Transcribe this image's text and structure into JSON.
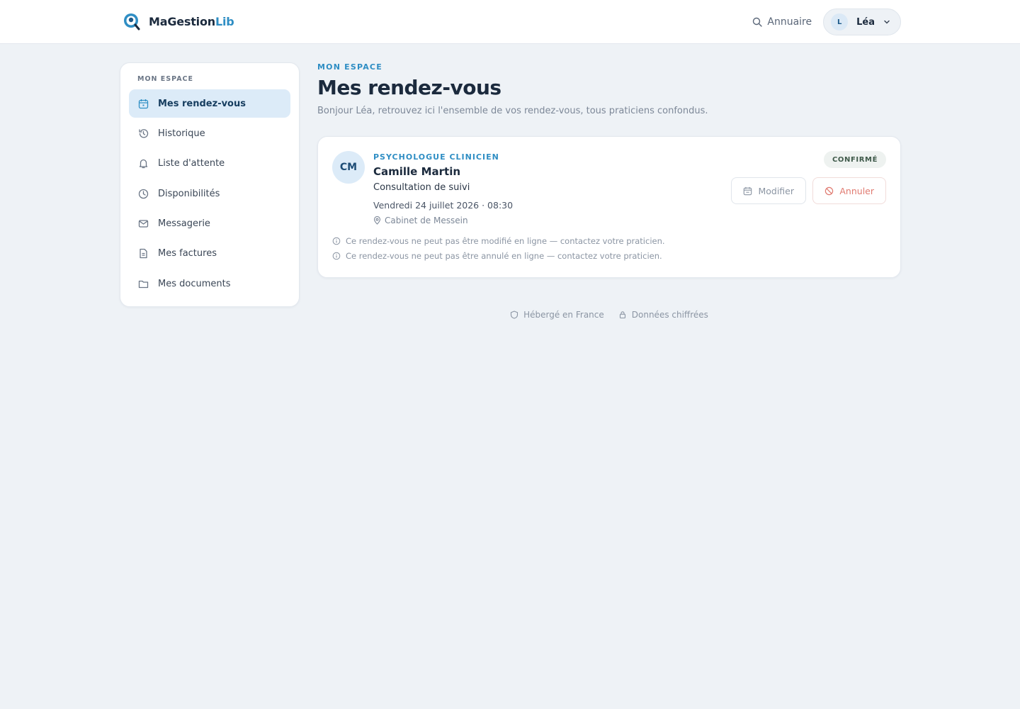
{
  "header": {
    "brand_main": "MaGestion",
    "brand_accent": "Lib",
    "directory_label": "Annuaire",
    "user_initial": "L",
    "user_name": "Léa"
  },
  "sidebar": {
    "title": "MON ESPACE",
    "items": [
      {
        "label": "Mes rendez-vous",
        "icon": "calendar-icon",
        "active": true
      },
      {
        "label": "Historique",
        "icon": "history-icon"
      },
      {
        "label": "Liste d'attente",
        "icon": "bell-icon"
      },
      {
        "label": "Disponibilités",
        "icon": "clock-icon"
      },
      {
        "label": "Messagerie",
        "icon": "mail-icon"
      },
      {
        "label": "Mes factures",
        "icon": "invoice-icon"
      },
      {
        "label": "Mes documents",
        "icon": "folder-icon"
      }
    ]
  },
  "main": {
    "eyebrow": "MON ESPACE",
    "title": "Mes rendez-vous",
    "subtitle": "Bonjour Léa, retrouvez ici l'ensemble de vos rendez-vous, tous praticiens confondus."
  },
  "appointment": {
    "initials": "CM",
    "specialty": "PSYCHOLOGUE CLINICIEN",
    "practitioner": "Camille Martin",
    "reason": "Consultation de suivi",
    "datetime": "Vendredi 24 juillet 2026 · 08:30",
    "location": "Cabinet de Messein",
    "status": "CONFIRMÉ",
    "modify_label": "Modifier",
    "cancel_label": "Annuler",
    "notes": [
      "Ce rendez-vous ne peut pas être modifié en ligne — contactez votre praticien.",
      "Ce rendez-vous ne peut pas être annulé en ligne — contactez votre praticien."
    ]
  },
  "trust": {
    "hosted": "Hébergé en France",
    "encrypted": "Données chiffrées"
  },
  "colors": {
    "accent": "#2f8ec4",
    "background": "#eef2f6",
    "danger": "#e07a70"
  }
}
